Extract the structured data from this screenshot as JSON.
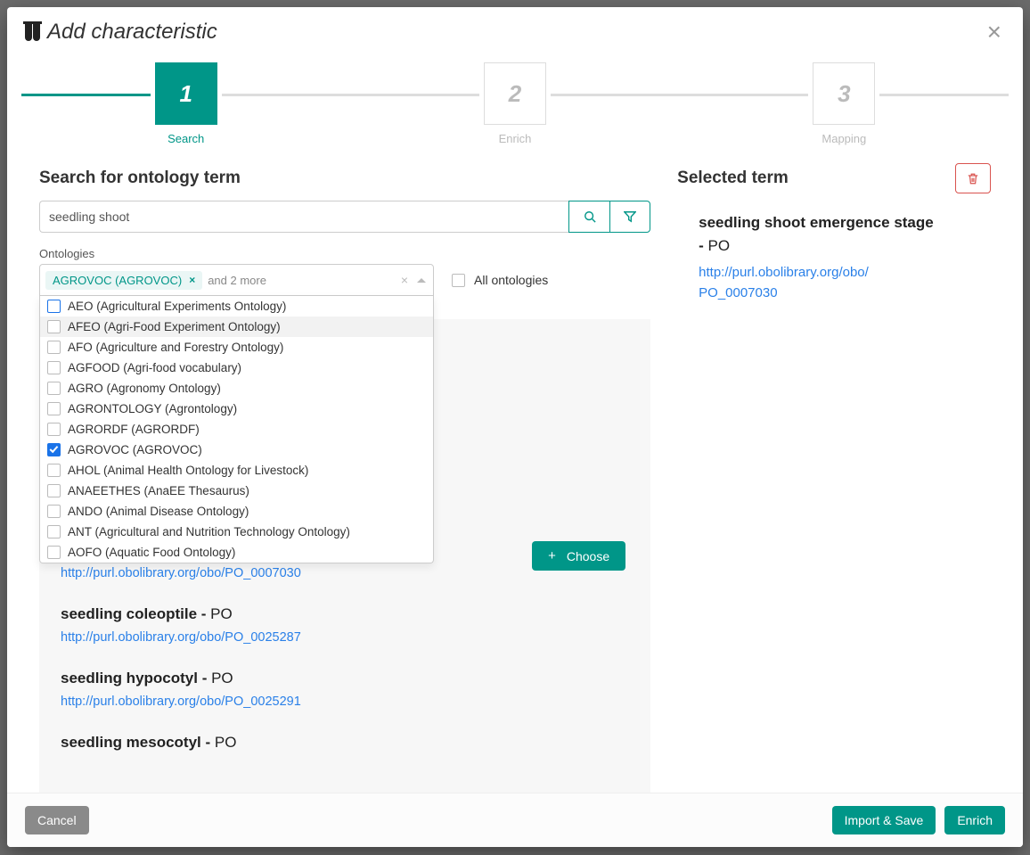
{
  "modal": {
    "title": "Add characteristic"
  },
  "stepper": {
    "step1_num": "1",
    "step1_label": "Search",
    "step2_num": "2",
    "step2_label": "Enrich",
    "step3_num": "3",
    "step3_label": "Mapping"
  },
  "search": {
    "heading": "Search for ontology term",
    "value": "seedling shoot",
    "ontologies_label": "Ontologies",
    "tag0": "AGROVOC (AGROVOC)",
    "and_more": "and 2 more",
    "all_ontologies_label": "All ontologies"
  },
  "ontology_options": [
    {
      "label": "AEO (Agricultural Experiments Ontology)",
      "checked": false,
      "outline": true
    },
    {
      "label": "AFEO (Agri-Food Experiment Ontology)",
      "checked": false,
      "hover": true
    },
    {
      "label": "AFO (Agriculture and Forestry Ontology)",
      "checked": false
    },
    {
      "label": "AGFOOD (Agri-food vocabulary)",
      "checked": false
    },
    {
      "label": "AGRO (Agronomy Ontology)",
      "checked": false
    },
    {
      "label": "AGRONTOLOGY (Agrontology)",
      "checked": false
    },
    {
      "label": "AGRORDF (AGRORDF)",
      "checked": false
    },
    {
      "label": "AGROVOC (AGROVOC)",
      "checked": true
    },
    {
      "label": "AHOL (Animal Health Ontology for Livestock)",
      "checked": false
    },
    {
      "label": "ANAEETHES (AnaEE Thesaurus)",
      "checked": false
    },
    {
      "label": "ANDO (Animal Disease Ontology)",
      "checked": false
    },
    {
      "label": "ANT (Agricultural and Nutrition Technology Ontology)",
      "checked": false
    },
    {
      "label": "AOFO (Aquatic Food Ontology)",
      "checked": false
    }
  ],
  "results": {
    "choose_label": "Choose",
    "items": [
      {
        "term": "seedling shoot emergence stage",
        "onto": "PO",
        "link": "http://purl.obolibrary.org/obo/PO_0007030",
        "choose": true
      },
      {
        "term": "seedling coleoptile",
        "onto": "PO",
        "link": "http://purl.obolibrary.org/obo/PO_0025287"
      },
      {
        "term": "seedling hypocotyl",
        "onto": "PO",
        "link": "http://purl.obolibrary.org/obo/PO_0025291"
      },
      {
        "term": "seedling mesocotyl",
        "onto": "PO",
        "link": ""
      }
    ]
  },
  "selected": {
    "heading": "Selected term",
    "term": "seedling shoot emergence stage",
    "dash": " - ",
    "onto": "PO",
    "link_line1": "http://purl.obolibrary.org/obo/",
    "link_line2": "PO_0007030"
  },
  "footer": {
    "cancel": "Cancel",
    "import_save": "Import & Save",
    "enrich": "Enrich"
  }
}
